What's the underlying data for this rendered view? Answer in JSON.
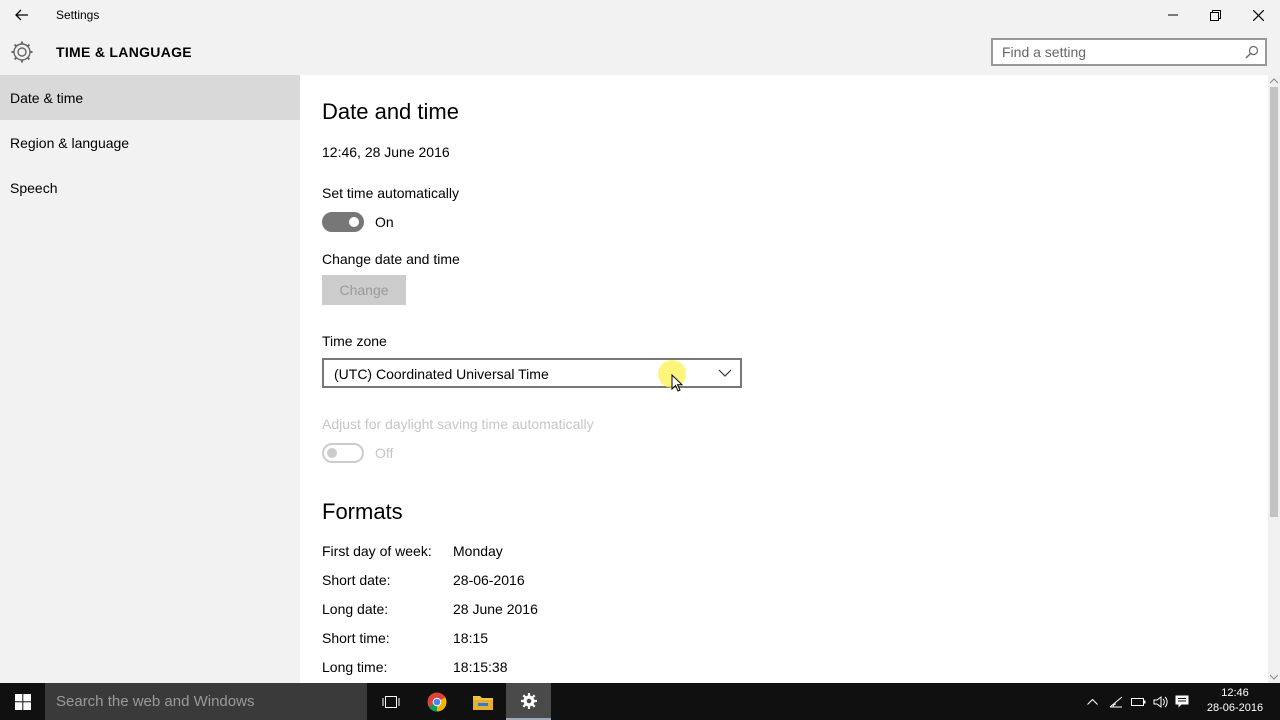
{
  "window": {
    "title": "Settings",
    "section_title": "TIME & LANGUAGE",
    "search_placeholder": "Find a setting"
  },
  "sidebar": {
    "items": [
      {
        "label": "Date & time",
        "active": true
      },
      {
        "label": "Region & language",
        "active": false
      },
      {
        "label": "Speech",
        "active": false
      }
    ]
  },
  "main": {
    "heading": "Date and time",
    "current_datetime": "12:46, 28 June 2016",
    "set_time_auto": {
      "label": "Set time automatically",
      "state": "On"
    },
    "change": {
      "label": "Change date and time",
      "button": "Change"
    },
    "timezone": {
      "label": "Time zone",
      "value": "(UTC) Coordinated Universal Time"
    },
    "daylight": {
      "label": "Adjust for daylight saving time automatically",
      "state": "Off"
    },
    "formats": {
      "heading": "Formats",
      "rows": [
        {
          "label": "First day of week:",
          "value": "Monday"
        },
        {
          "label": "Short date:",
          "value": "28-06-2016"
        },
        {
          "label": "Long date:",
          "value": "28 June 2016"
        },
        {
          "label": "Short time:",
          "value": "18:15"
        },
        {
          "label": "Long time:",
          "value": "18:15:38"
        }
      ]
    }
  },
  "taskbar": {
    "search_placeholder": "Search the web and Windows",
    "clock_time": "12:46",
    "clock_date": "28-06-2016"
  },
  "colors": {
    "sidebar_bg": "#f2f2f2",
    "active_item_bg": "#d9d9d9",
    "taskbar_bg": "#101010",
    "toggle_on": "#777777"
  }
}
